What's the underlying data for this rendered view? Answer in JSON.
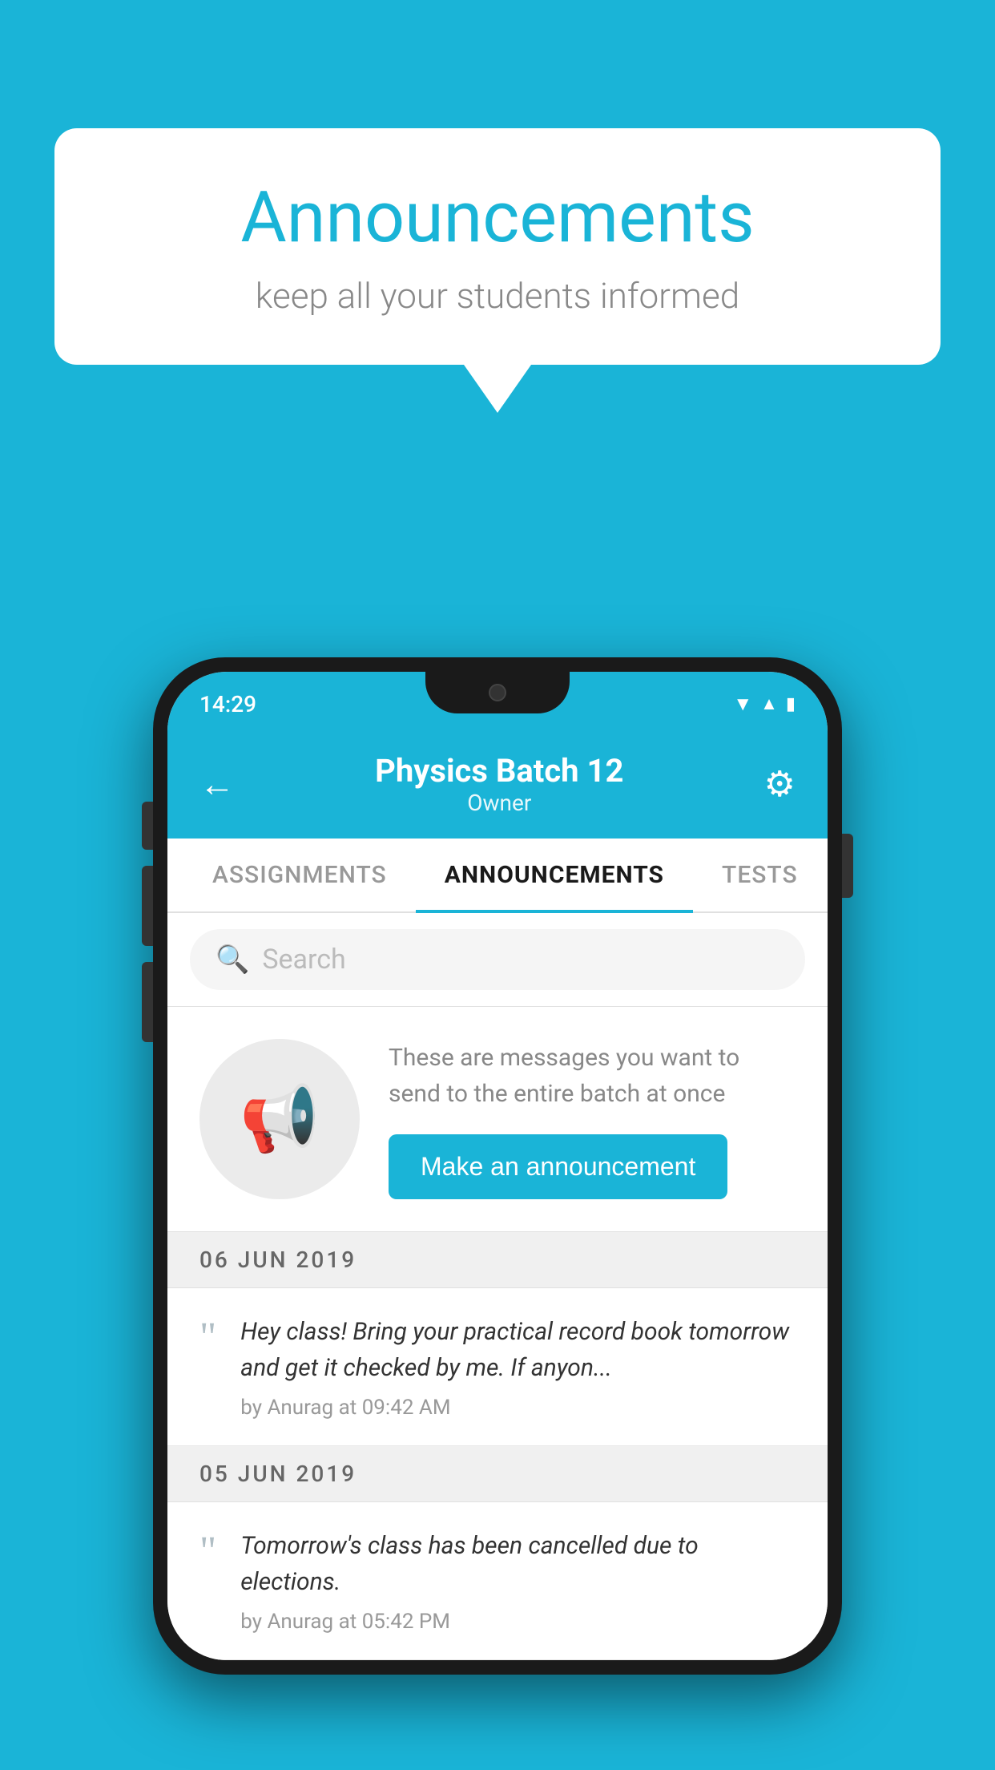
{
  "page": {
    "background_color": "#1ab4d7"
  },
  "speech_bubble": {
    "title": "Announcements",
    "subtitle": "keep all your students informed"
  },
  "phone": {
    "status_bar": {
      "time": "14:29",
      "wifi_icon": "wifi",
      "signal_icon": "signal",
      "battery_icon": "battery"
    },
    "header": {
      "back_label": "←",
      "title": "Physics Batch 12",
      "subtitle": "Owner",
      "gear_label": "⚙"
    },
    "tabs": [
      {
        "label": "ASSIGNMENTS",
        "active": false
      },
      {
        "label": "ANNOUNCEMENTS",
        "active": true
      },
      {
        "label": "TESTS",
        "active": false
      },
      {
        "label": "...",
        "active": false
      }
    ],
    "search": {
      "placeholder": "Search"
    },
    "promo": {
      "description": "These are messages you want to send to the entire batch at once",
      "button_label": "Make an announcement"
    },
    "announcements": [
      {
        "date": "06  JUN  2019",
        "text": "Hey class! Bring your practical record book tomorrow and get it checked by me. If anyon...",
        "meta": "by Anurag at 09:42 AM"
      },
      {
        "date": "05  JUN  2019",
        "text": "Tomorrow's class has been cancelled due to elections.",
        "meta": "by Anurag at 05:42 PM"
      }
    ]
  }
}
